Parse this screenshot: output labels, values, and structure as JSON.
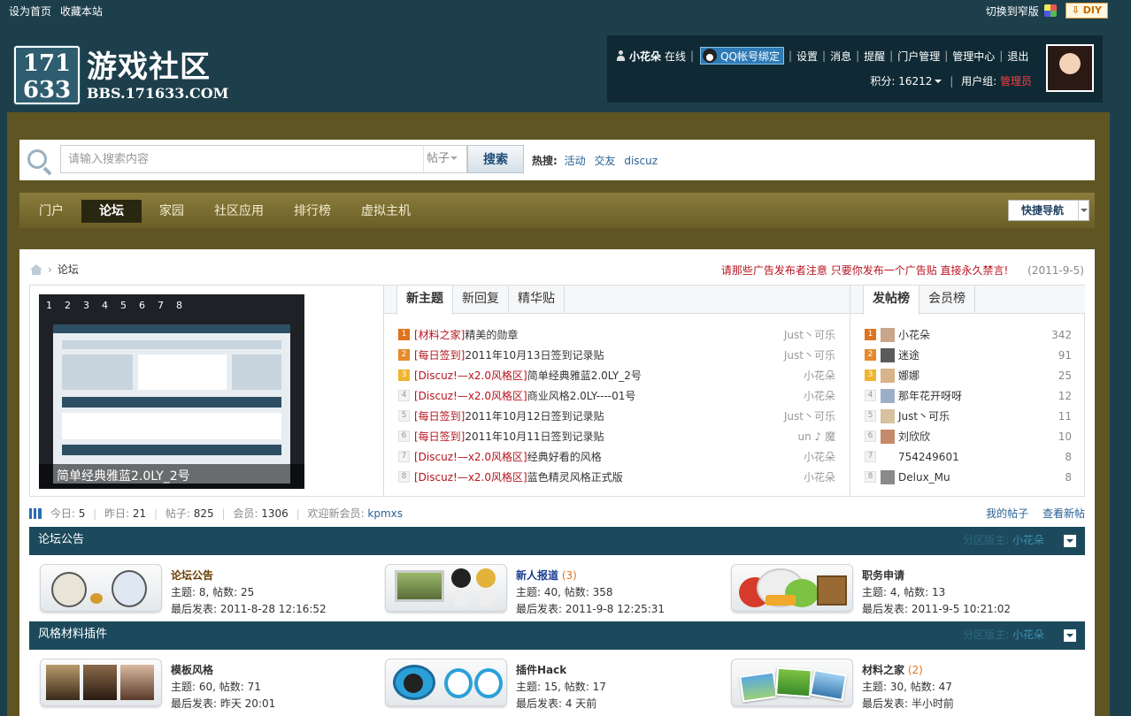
{
  "topbar": {
    "set_home": "设为首页",
    "bookmark": "收藏本站",
    "switch_width": "切换到窄版",
    "diy": "DIY"
  },
  "logo": {
    "num_top": "171",
    "num_bottom": "633",
    "title": "游戏社区",
    "domain": "BBS.171633.COM"
  },
  "user": {
    "name": "小花朵",
    "status": "在线",
    "qq_bind": "QQ帐号绑定",
    "links": [
      "设置",
      "消息",
      "提醒",
      "门户管理",
      "管理中心",
      "退出"
    ],
    "points_label": "积分: 16212",
    "group_label": "用户组:",
    "group": "管理员"
  },
  "search": {
    "placeholder": "请输入搜索内容",
    "type": "帖子",
    "button": "搜索",
    "hot_label": "热搜:",
    "hot_keywords": [
      "活动",
      "交友",
      "discuz"
    ]
  },
  "nav": {
    "items": [
      "门户",
      "论坛",
      "家园",
      "社区应用",
      "排行榜",
      "虚拟主机"
    ],
    "active_index": 1,
    "quick_nav": "快捷导航"
  },
  "breadcrumb": {
    "current": "论坛"
  },
  "notice": {
    "message": "请那些广告发布者注意 只要你发布一个广告贴 直接永久禁言!",
    "date": "(2011-9-5)"
  },
  "slideshow": {
    "numbers": [
      "1",
      "2",
      "3",
      "4",
      "5",
      "6",
      "7",
      "8"
    ],
    "caption": "简单经典雅蓝2.0LY_2号"
  },
  "thread_tabs": [
    "新主题",
    "新回复",
    "精华贴"
  ],
  "threads": [
    {
      "rank": "1",
      "category": "[材料之家]",
      "title": "精美的勋章",
      "author": "Just丶可乐"
    },
    {
      "rank": "2",
      "category": "[每日签到]",
      "title": "2011年10月13日签到记录贴",
      "author": "Just丶可乐"
    },
    {
      "rank": "3",
      "category": "[Discuz!—x2.0风格区]",
      "title": "简单经典雅蓝2.0LY_2号",
      "author": "小花朵"
    },
    {
      "rank": "4",
      "category": "[Discuz!—x2.0风格区]",
      "title": "商业风格2.0LY----01号",
      "author": "小花朵"
    },
    {
      "rank": "5",
      "category": "[每日签到]",
      "title": "2011年10月12日签到记录贴",
      "author": "Just丶可乐"
    },
    {
      "rank": "6",
      "category": "[每日签到]",
      "title": "2011年10月11日签到记录贴",
      "author": "un ♪ 魔"
    },
    {
      "rank": "7",
      "category": "[Discuz!—x2.0风格区]",
      "title": "经典好看的风格",
      "author": "小花朵"
    },
    {
      "rank": "8",
      "category": "[Discuz!—x2.0风格区]",
      "title": "蓝色精灵风格正式版",
      "author": "小花朵"
    }
  ],
  "rank_tabs": [
    "发帖榜",
    "会员榜"
  ],
  "ranking": [
    {
      "rank": "1",
      "name": "小花朵",
      "count": "342"
    },
    {
      "rank": "2",
      "name": "迷途",
      "count": "91"
    },
    {
      "rank": "3",
      "name": "娜娜",
      "count": "25"
    },
    {
      "rank": "4",
      "name": "那年花开呀呀",
      "count": "12"
    },
    {
      "rank": "5",
      "name": "Just丶可乐",
      "count": "11"
    },
    {
      "rank": "6",
      "name": "刘欣欣",
      "count": "10"
    },
    {
      "rank": "7",
      "name": "754249601",
      "count": "8"
    },
    {
      "rank": "8",
      "name": "Delux_Mu",
      "count": "8"
    }
  ],
  "stats": {
    "today_label": "今日:",
    "today": "5",
    "yesterday_label": "昨日:",
    "yesterday": "21",
    "posts_label": "帖子:",
    "posts": "825",
    "members_label": "会员:",
    "members": "1306",
    "newmember_label": "欢迎新会员:",
    "newmember": "kpmxs",
    "my_posts": "我的帖子",
    "view_new": "查看新帖"
  },
  "sections": [
    {
      "title": "论坛公告",
      "moderator_label": "分区版主:",
      "moderator": "小花朵",
      "forums": [
        {
          "name": "论坛公告",
          "new_count": "",
          "stats": "主题: 8, 帖数: 25",
          "last_post": "最后发表: 2011-8-28 12:16:52"
        },
        {
          "name": "新人报道",
          "new_count": "(3)",
          "stats": "主题: 40, 帖数: 358",
          "last_post": "最后发表: 2011-9-8 12:25:31"
        },
        {
          "name": "职务申请",
          "new_count": "",
          "stats": "主题: 4, 帖数: 13",
          "last_post": "最后发表: 2011-9-5 10:21:02"
        }
      ]
    },
    {
      "title": "风格材料插件",
      "moderator_label": "分区版主:",
      "moderator": "小花朵",
      "forums": [
        {
          "name": "模板风格",
          "new_count": "",
          "stats": "主题: 60, 帖数: 71",
          "last_post": "最后发表: 昨天 20:01"
        },
        {
          "name": "插件Hack",
          "new_count": "",
          "stats": "主题: 15, 帖数: 17",
          "last_post": "最后发表: 4 天前"
        },
        {
          "name": "材料之家",
          "new_count": "(2)",
          "stats": "主题: 30, 帖数: 47",
          "last_post": "最后发表: 半小时前"
        }
      ]
    }
  ]
}
